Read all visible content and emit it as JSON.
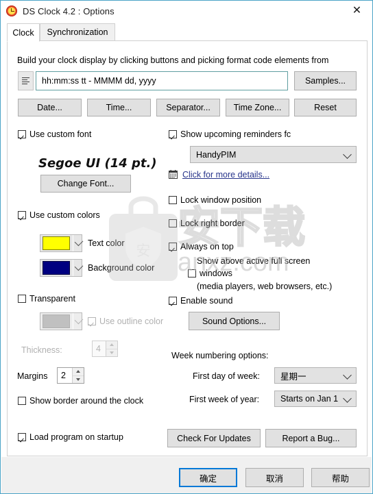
{
  "window": {
    "title": "DS Clock 4.2 : Options",
    "icon": "clock-icon",
    "close_label": "✕",
    "accent": "#0078d7"
  },
  "tabs": [
    {
      "label": "Clock",
      "active": true
    },
    {
      "label": "Synchronization",
      "active": false
    }
  ],
  "clock_tab": {
    "intro": "Build your clock display by clicking buttons and picking format code elements from",
    "format": {
      "menu_icon": "hamburger-menu-icon",
      "value": "hh:mm:ss tt - MMMM dd, yyyy",
      "samples_button": "Samples..."
    },
    "format_buttons": [
      "Date...",
      "Time...",
      "Separator...",
      "Time Zone...",
      "Reset"
    ],
    "left": {
      "use_custom_font": {
        "label": "Use custom font",
        "checked": true
      },
      "font_sample": "Segoe UI (14 pt.)",
      "change_font_button": "Change Font...",
      "use_custom_colors": {
        "label": "Use custom colors",
        "checked": true
      },
      "text_color": {
        "label": "Text color",
        "value": "#ffff00",
        "border": "#808000"
      },
      "background_color": {
        "label": "Background color",
        "value": "#000080",
        "border": "#000040"
      },
      "transparent": {
        "label": "Transparent",
        "checked": false
      },
      "outline_color": {
        "value": "#c0c0c0",
        "disabled": true
      },
      "use_outline_color": {
        "label": "Use outline color",
        "checked": true,
        "disabled": true
      },
      "thickness": {
        "label": "Thickness:",
        "value": "4",
        "disabled": true
      },
      "margins": {
        "label": "Margins",
        "value": "2"
      },
      "show_border": {
        "label": "Show border around the clock",
        "checked": false
      },
      "load_on_startup": {
        "label": "Load program on startup",
        "checked": true
      }
    },
    "right": {
      "show_reminders": {
        "label": "Show upcoming reminders fc",
        "checked": true
      },
      "reminders_source": {
        "value": "HandyPIM"
      },
      "details_link": {
        "label": "Click for more details...",
        "icon": "calendar-icon"
      },
      "lock_window_position": {
        "label": "Lock window position",
        "checked": false
      },
      "lock_right_border": {
        "label": "Lock right border",
        "checked": false
      },
      "always_on_top": {
        "label": "Always on top",
        "checked": true
      },
      "show_above_fullscreen": {
        "line1": "Show above active full screen",
        "label": "windows",
        "line3": "(media players, web browsers, etc.)",
        "checked": false
      },
      "enable_sound": {
        "label": "Enable sound",
        "checked": true
      },
      "sound_options_button": "Sound Options...",
      "week_numbering_title": "Week numbering options:",
      "first_day_of_week": {
        "label": "First day of week:",
        "value": "星期一"
      },
      "first_week_of_year": {
        "label": "First week of year:",
        "value": "Starts on Jan 1"
      }
    },
    "action_buttons": [
      "Check For Updates",
      "Report a Bug..."
    ]
  },
  "footer": {
    "ok": "确定",
    "cancel": "取消",
    "help": "帮助"
  },
  "watermark": {
    "cn_text": "安下载",
    "site": "anxz.com",
    "badge_char": "安"
  }
}
